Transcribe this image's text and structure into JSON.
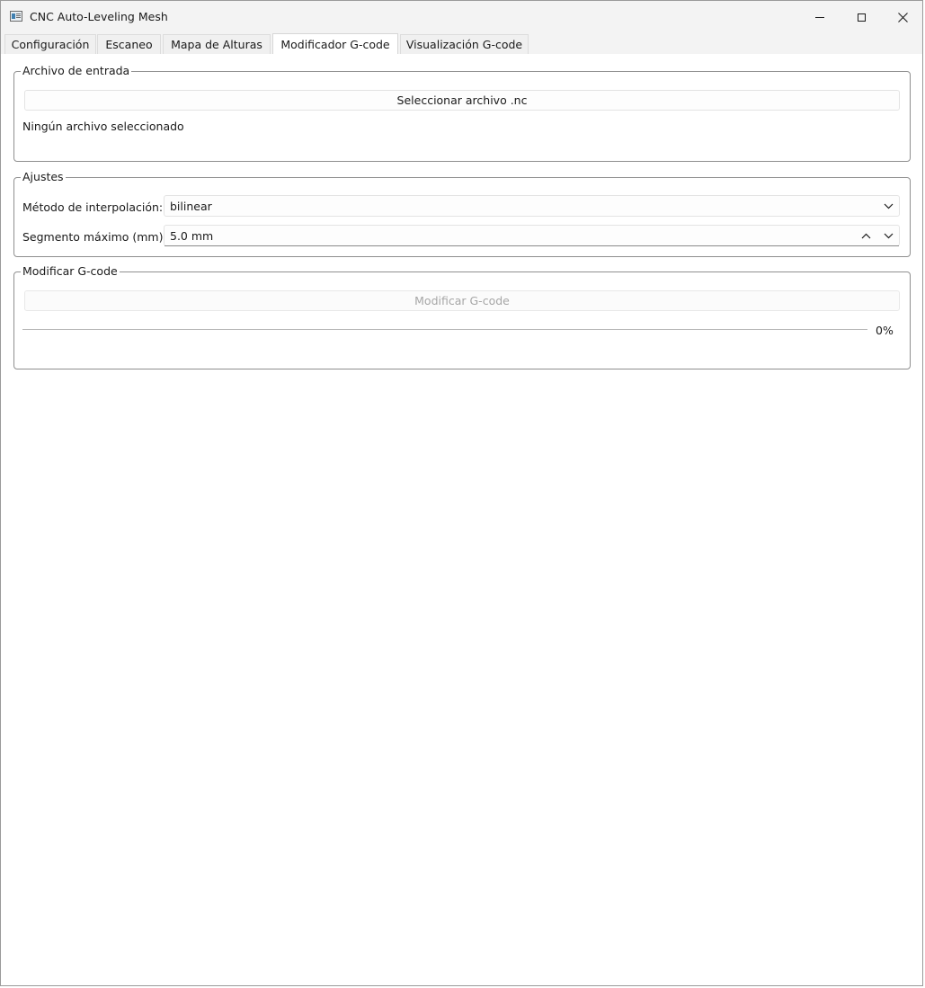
{
  "window": {
    "title": "CNC Auto-Leveling Mesh",
    "controls": {
      "minimize": "minimize-icon",
      "maximize": "maximize-icon",
      "close": "close-icon"
    }
  },
  "tabs": [
    {
      "label": "Configuración",
      "active": false
    },
    {
      "label": "Escaneo",
      "active": false
    },
    {
      "label": "Mapa de Alturas",
      "active": false
    },
    {
      "label": "Modificador G-code",
      "active": true
    },
    {
      "label": "Visualización G-code",
      "active": false
    }
  ],
  "input_group": {
    "title": "Archivo de entrada",
    "select_button": "Seleccionar archivo .nc",
    "status": "Ningún archivo seleccionado"
  },
  "settings_group": {
    "title": "Ajustes",
    "interpolation_label": "Método de interpolación:",
    "interpolation_value": "bilinear",
    "segment_label": "Segmento máximo (mm):",
    "segment_value": "5.0 mm"
  },
  "modify_group": {
    "title": "Modificar G-code",
    "modify_button": "Modificar G-code",
    "modify_button_enabled": false,
    "progress_percent": 0,
    "progress_text": "0%"
  }
}
